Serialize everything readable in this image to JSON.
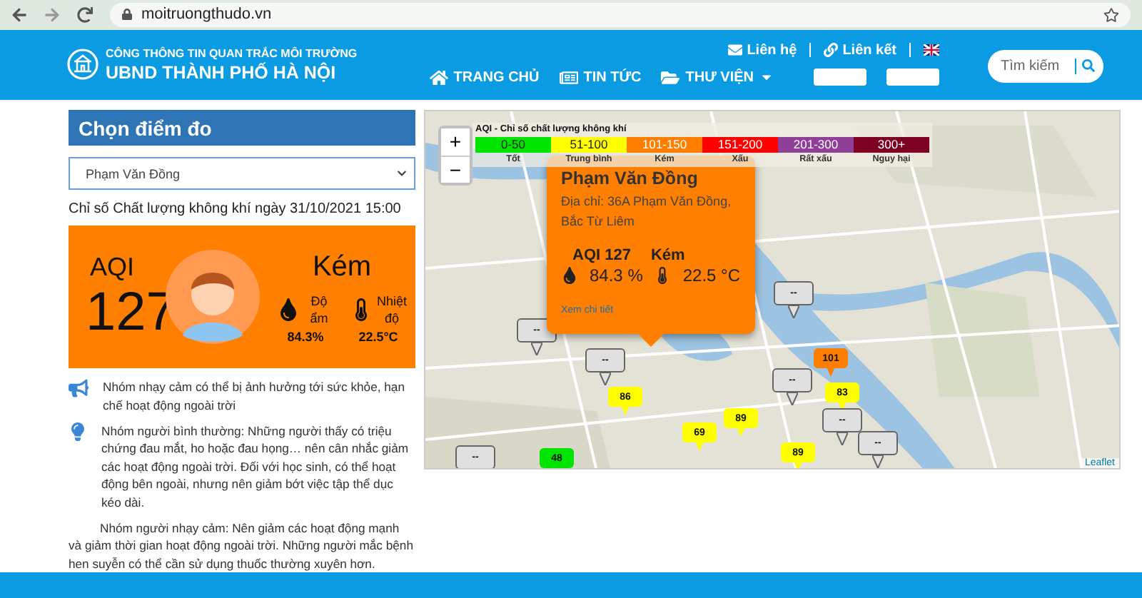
{
  "browser": {
    "url": "moitruongthudo.vn"
  },
  "header": {
    "portal_title": "CÔNG THÔNG TIN QUAN TRẮC MÔI TRƯỜNG",
    "org_title": "UBND THÀNH PHỐ HÀ NỘI",
    "top_links": [
      {
        "label": "Liên hệ",
        "kind": "mail"
      },
      {
        "label": "Liên kết",
        "kind": "link"
      }
    ],
    "nav": [
      {
        "label": "TRANG CHỦ",
        "kind": "home",
        "dropdown": false
      },
      {
        "label": "TIN TỨC",
        "kind": "news",
        "dropdown": false
      },
      {
        "label": "THƯ VIỆN",
        "kind": "folder",
        "dropdown": true
      }
    ],
    "search": {
      "placeholder": "Tìm kiếm"
    }
  },
  "station_panel": {
    "title": "Chọn điểm đo",
    "selected_station": "Phạm Văn Đồng",
    "timestamp_label": "Chỉ số Chất lượng không khí ngày 31/10/2021 15:00",
    "aqi_label": "AQI",
    "aqi_value": "127",
    "category": "Kém",
    "humidity_label": "Độ ẩm",
    "humidity": "84.3%",
    "temperature_label": "Nhiệt độ",
    "temperature": "22.5°C"
  },
  "advice": [
    {
      "kind": "megaphone",
      "text": "Nhóm nhạy cảm có thể bị ảnh hưởng tới sức khỏe, hạn chế hoạt động ngoài trời"
    },
    {
      "kind": "bulb",
      "text": "Nhóm người bình thường: Những người thấy có triệu chứng đau mắt, ho hoặc đau họng… nên cân nhắc giảm các hoạt động ngoài trời. Đối với học sinh, có thể hoạt động bên ngoài, nhưng nên giảm bớt việc tập thể dục kéo dài."
    },
    {
      "kind": "plain",
      "text": "Nhóm người nhạy cảm: Nên giảm các hoạt động mạnh và giảm thời gian hoạt động ngoài trời. Những người mắc bệnh hen suyễn có thể cần sử dụng thuốc thường xuyên hơn."
    }
  ],
  "map": {
    "zoom_in": "+",
    "zoom_out": "−",
    "legend_title": "AQI - Chỉ số chất lượng không khí",
    "legend": [
      {
        "range": "0-50",
        "label": "Tốt",
        "color": "#00e400"
      },
      {
        "range": "51-100",
        "label": "Trung bình",
        "color": "#ffff00"
      },
      {
        "range": "101-150",
        "label": "Kém",
        "color": "#ff7e00"
      },
      {
        "range": "151-200",
        "label": "Xấu",
        "color": "#ff0000"
      },
      {
        "range": "201-300",
        "label": "Rất xấu",
        "color": "#8f3f97"
      },
      {
        "range": "300+",
        "label": "Nguy hại",
        "color": "#7e0023"
      }
    ],
    "popup": {
      "station": "Phạm Văn Đồng",
      "address": "Địa chỉ: 36A Phạm Văn Đồng, Bắc Từ Liêm",
      "aqi": "AQI 127",
      "category": "Kém",
      "humidity": "84.3 %",
      "temperature": "22.5 °C",
      "link": "Xem chi tiết"
    },
    "markers": [
      {
        "label": "--",
        "color": "#e0e0e0"
      },
      {
        "label": "--",
        "color": "#e0e0e0"
      },
      {
        "label": "--",
        "color": "#e0e0e0"
      },
      {
        "label": "86",
        "color": "#ffff00"
      },
      {
        "label": "69",
        "color": "#ffff00"
      },
      {
        "label": "89",
        "color": "#ffff00"
      },
      {
        "label": "89",
        "color": "#ffff00"
      },
      {
        "label": "48",
        "color": "#00e400"
      },
      {
        "label": "--",
        "color": "#e0e0e0"
      },
      {
        "label": "101",
        "color": "#ff7e00"
      },
      {
        "label": "--",
        "color": "#e0e0e0"
      },
      {
        "label": "83",
        "color": "#ffff00"
      },
      {
        "label": "--",
        "color": "#e0e0e0"
      },
      {
        "label": "--",
        "color": "#e0e0e0"
      }
    ],
    "attribution": "Leaflet"
  }
}
